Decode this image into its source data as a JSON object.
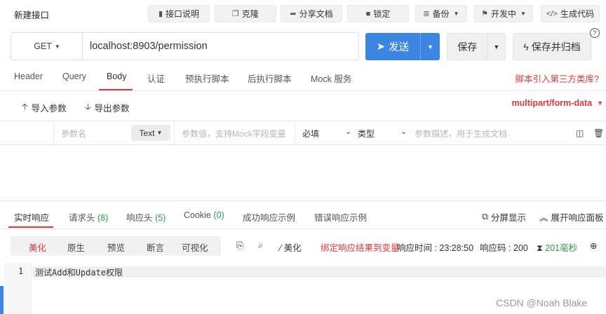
{
  "header": {
    "title": "新建接口",
    "buttons": [
      {
        "icon": "api-doc-icon",
        "glyph": "▮",
        "label": "接口说明"
      },
      {
        "icon": "clone-icon",
        "glyph": "❐",
        "label": "克隆"
      },
      {
        "icon": "share-icon",
        "glyph": "➦",
        "label": "分享文档"
      },
      {
        "icon": "lock-icon",
        "glyph": "🔒︎",
        "label": "锁定"
      },
      {
        "icon": "database-icon",
        "glyph": "≣",
        "label": "备份"
      },
      {
        "icon": "flag-icon",
        "glyph": "⚑",
        "label": "开发中"
      },
      {
        "icon": "code-icon",
        "glyph": "</>",
        "label": "生成代码"
      }
    ]
  },
  "request": {
    "method": "GET",
    "url": "localhost:8903/permission",
    "send_label": "发送",
    "save_label": "保存",
    "save_archive_label": "保存并归档",
    "help_glyph": "?"
  },
  "tabs": {
    "items": [
      "Header",
      "Query",
      "Body",
      "认证",
      "预执行脚本",
      "后执行脚本",
      "Mock 服务"
    ],
    "active": "Body",
    "third_party_link": "脚本引入第三方类库?"
  },
  "params": {
    "import_label": "导入参数",
    "export_label": "导出参数",
    "content_type": "multipart/form-data",
    "row": {
      "name_placeholder": "参数名",
      "type_value": "Text",
      "value_placeholder": "参数值，支持Mock字段变量",
      "required": "必填",
      "type_label": "类型",
      "desc_placeholder": "参数描述，用于生成文档"
    }
  },
  "response": {
    "tabs": [
      {
        "label": "实时响应",
        "count": ""
      },
      {
        "label": "请求头",
        "count": "(8)"
      },
      {
        "label": "响应头",
        "count": "(5)"
      },
      {
        "label": "Cookie",
        "count": "(0)"
      },
      {
        "label": "成功响应示例",
        "count": ""
      },
      {
        "label": "错误响应示例",
        "count": ""
      }
    ],
    "active_tab": "实时响应",
    "split_label": "分屏显示",
    "expand_label": "展开响应面板",
    "views": [
      "美化",
      "原生",
      "预览",
      "断言",
      "可视化"
    ],
    "active_view": "美化",
    "beautify_label": "美化",
    "bind_var_label": "绑定响应结果到变量",
    "time_label": "响应时间 : 23:28:50",
    "code_label": "响应码 : 200",
    "duration": "201毫秒",
    "body_lines": [
      {
        "number": "1",
        "text": "测试Add和Update权限"
      }
    ]
  },
  "watermark": "CSDN @Noah Blake",
  "colors": {
    "accent": "#e4393c",
    "primary": "#3c85e0",
    "success": "#2e9a4a"
  }
}
